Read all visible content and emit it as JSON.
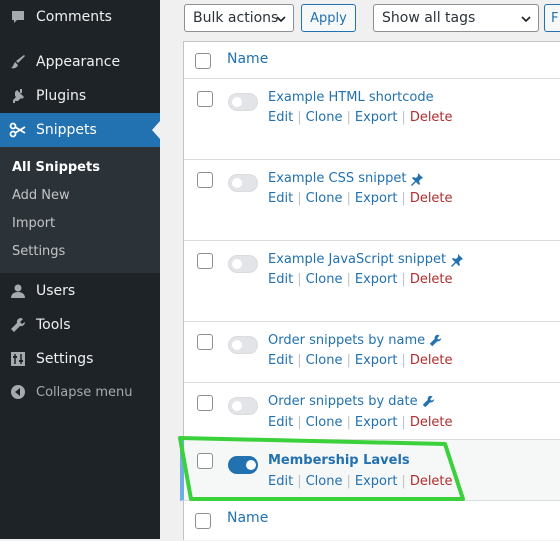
{
  "sidebar": {
    "items": [
      {
        "label": "Comments",
        "icon": "comment-icon"
      },
      {
        "label": "Appearance",
        "icon": "paintbrush-icon"
      },
      {
        "label": "Plugins",
        "icon": "plug-icon"
      },
      {
        "label": "Snippets",
        "icon": "scissors-icon",
        "active": true
      },
      {
        "label": "Users",
        "icon": "user-icon"
      },
      {
        "label": "Tools",
        "icon": "wrench-icon"
      },
      {
        "label": "Settings",
        "icon": "sliders-icon"
      }
    ],
    "submenu": [
      "All Snippets",
      "Add New",
      "Import",
      "Settings"
    ],
    "collapse_label": "Collapse menu",
    "accent": "#2271b1"
  },
  "toolbar": {
    "bulk_actions": "Bulk actions",
    "apply": "Apply",
    "tags_filter": "Show all tags",
    "partial_button": "F"
  },
  "table": {
    "header_label": "Name",
    "footer_label": "Name",
    "row_actions": {
      "edit": "Edit",
      "clone": "Clone",
      "export": "Export",
      "delete": "Delete"
    },
    "rows": [
      {
        "name": "Example HTML shortcode",
        "active": false,
        "icon": ""
      },
      {
        "name": "Example CSS snippet",
        "active": false,
        "icon": "pin-icon"
      },
      {
        "name": "Example JavaScript snippet",
        "active": false,
        "icon": "pin-icon"
      },
      {
        "name": "Order snippets by name",
        "active": false,
        "icon": "wrench-icon"
      },
      {
        "name": "Order snippets by date",
        "active": false,
        "icon": "wrench-icon"
      },
      {
        "name": "Membership Lavels",
        "active": true,
        "icon": ""
      }
    ]
  },
  "highlight_color": "#3ad13a"
}
